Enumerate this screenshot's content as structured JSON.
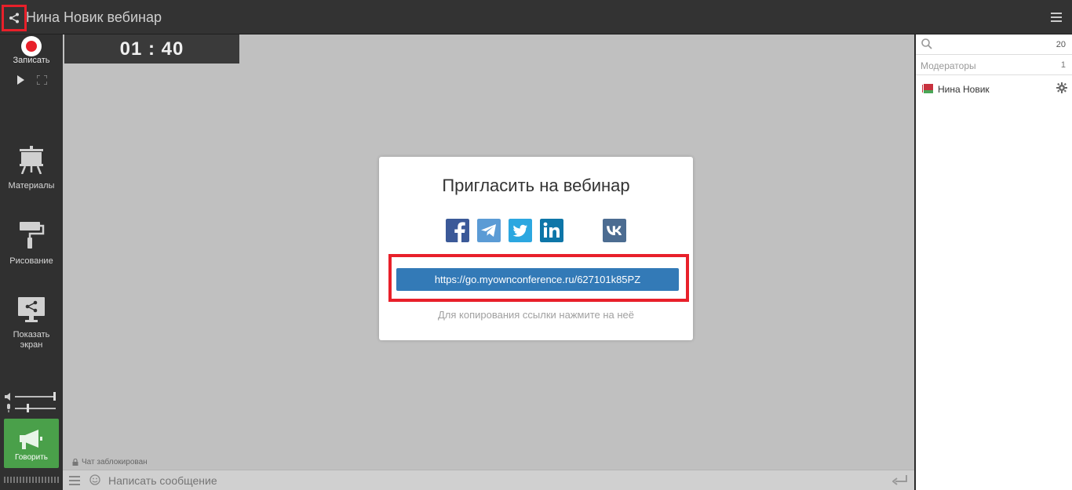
{
  "header": {
    "title": "Нина Новик вебинар"
  },
  "sidebar": {
    "record_label": "Записать",
    "tools": [
      {
        "label": "Материалы"
      },
      {
        "label": "Рисование"
      },
      {
        "label": "Показать экран"
      }
    ],
    "speak_label": "Говорить"
  },
  "main": {
    "timer": "01 : 40",
    "dialog": {
      "title": "Пригласить на вебинар",
      "social": [
        "facebook-icon",
        "telegram-icon",
        "twitter-icon",
        "linkedin-icon",
        "vk-icon"
      ],
      "link": "https://go.myownconference.ru/627101k85PZ",
      "hint": "Для копирования ссылки нажмите на неё"
    },
    "chat_locked": "Чат заблокирован"
  },
  "chat": {
    "placeholder": "Написать сообщение"
  },
  "right_panel": {
    "participant_count": "20",
    "moderators_label": "Модераторы",
    "moderators_count": "1",
    "users": [
      {
        "name": "Нина Новик"
      }
    ]
  },
  "colors": {
    "accent_red": "#e8202a",
    "link_blue": "#337ab7",
    "speak_green": "#4aa04a"
  }
}
